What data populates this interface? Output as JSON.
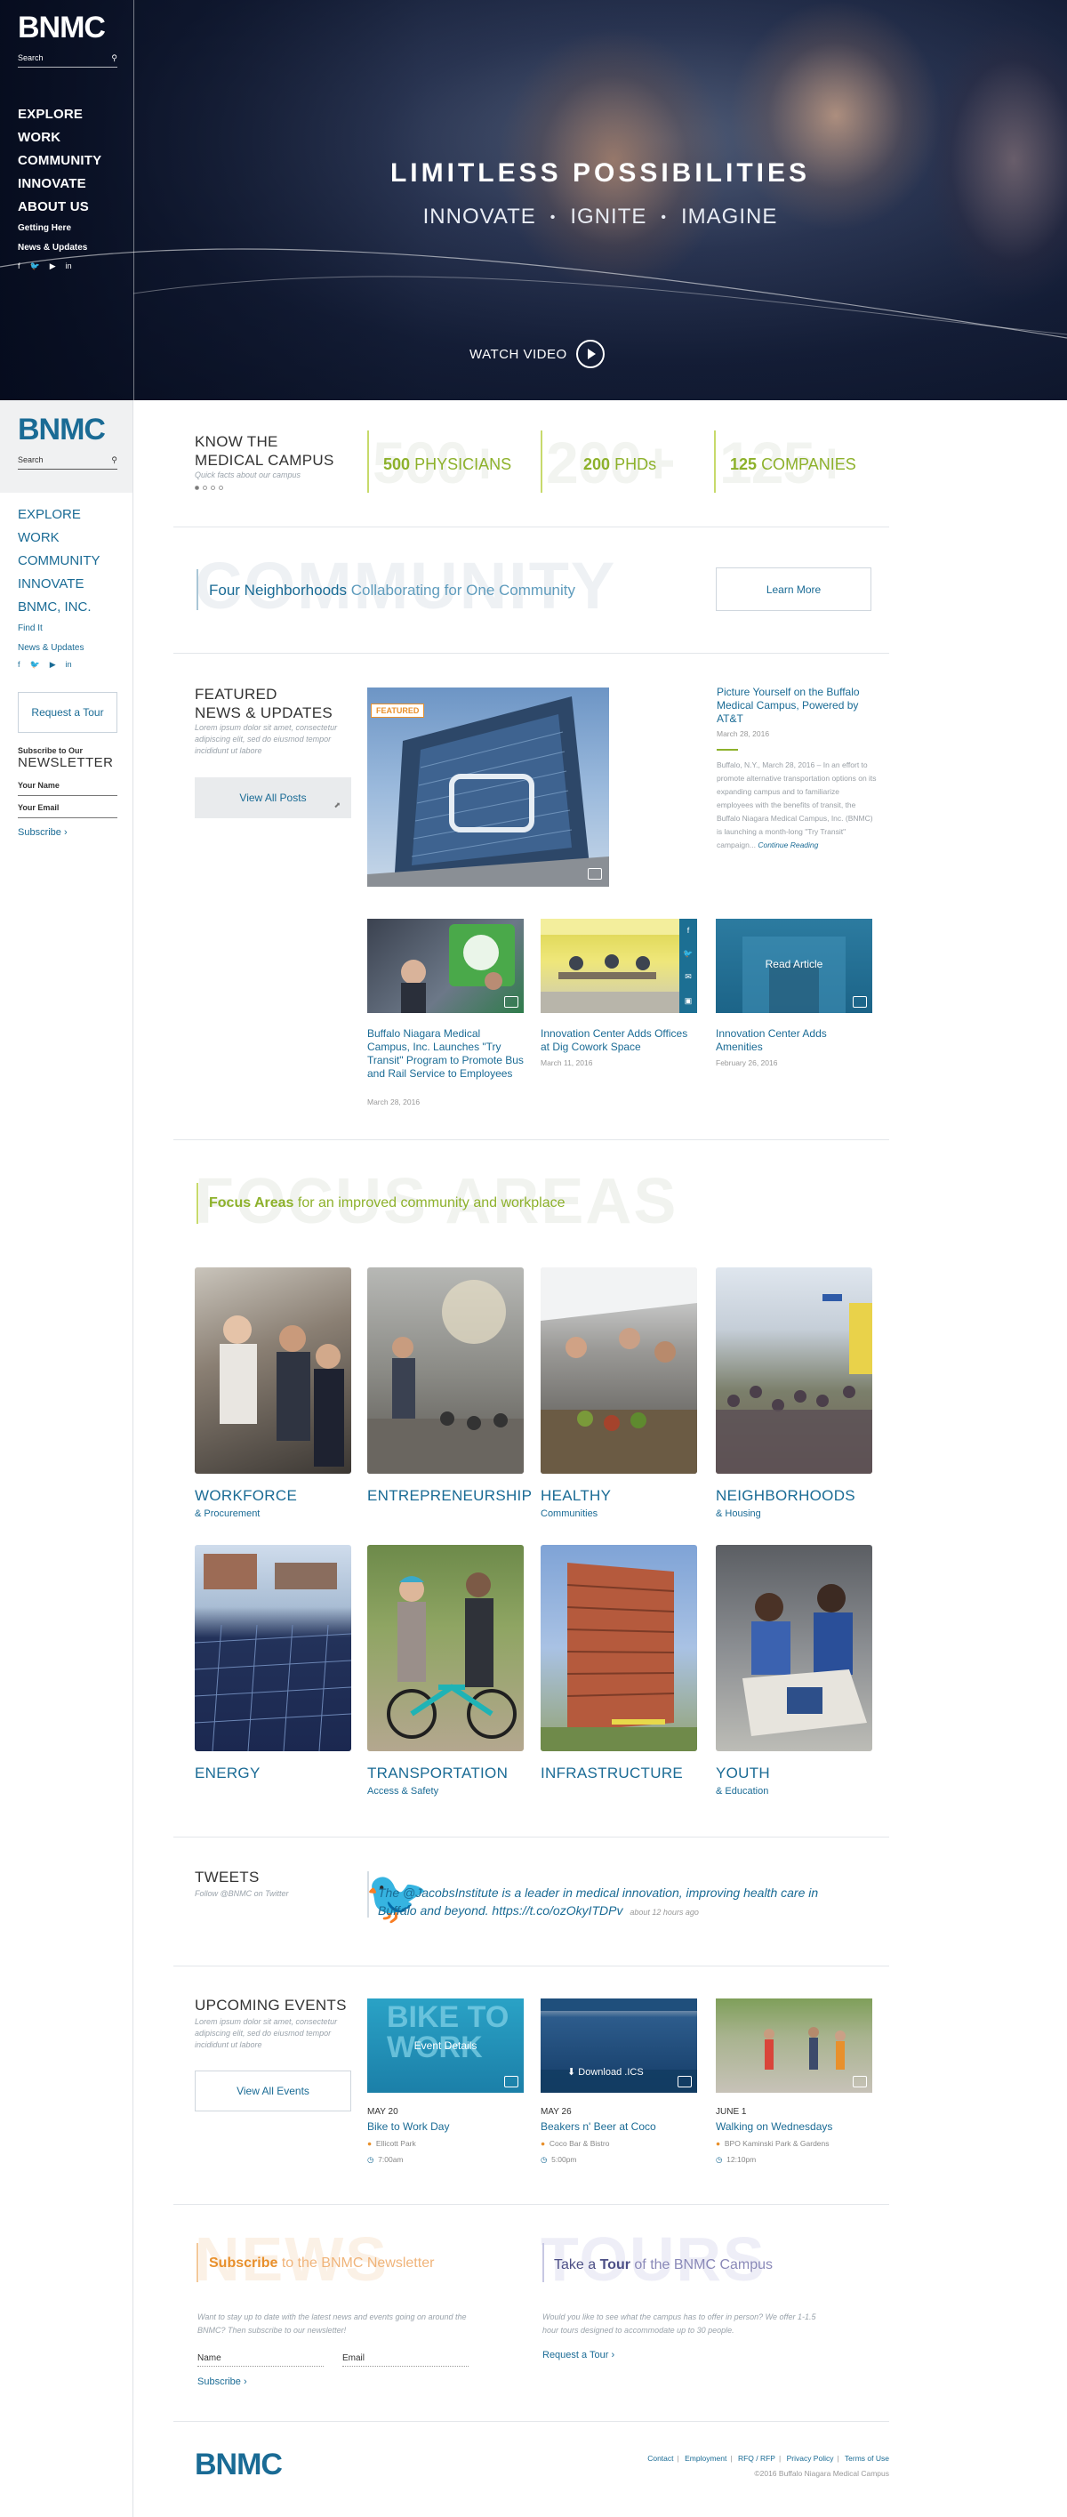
{
  "brand": {
    "logo": "BNMC",
    "accent": "#1a6b95",
    "green": "#8db12b",
    "orange": "#e8902c"
  },
  "hero": {
    "title": "LIMITLESS POSSIBILITIES",
    "subtitle": [
      "INNOVATE",
      "IGNITE",
      "IMAGINE"
    ],
    "watch_label": "WATCH VIDEO",
    "search_label": "Search",
    "menu_main": [
      "EXPLORE",
      "WORK",
      "COMMUNITY",
      "INNOVATE",
      "ABOUT US"
    ],
    "menu_small": [
      "Getting Here",
      "News & Updates"
    ]
  },
  "sidebar": {
    "search_label": "Search",
    "menu_main": [
      "EXPLORE",
      "WORK",
      "COMMUNITY",
      "INNOVATE",
      "BNMC, INC."
    ],
    "menu_small": [
      "Find It",
      "News & Updates"
    ],
    "social": [
      "facebook-icon",
      "twitter-icon",
      "youtube-icon",
      "linkedin-icon"
    ],
    "tour_button": "Request a Tour",
    "newsletter": {
      "small": "Subscribe to Our",
      "big": "NEWSLETTER",
      "name_label": "Your Name",
      "email_label": "Your Email",
      "subscribe": "Subscribe ›"
    }
  },
  "know": {
    "title_line1": "KNOW THE",
    "title_line2": "MEDICAL CAMPUS",
    "subtitle": "Quick facts about our campus",
    "stats": [
      {
        "ghost": "500+",
        "value": "500",
        "label": "PHYSICIANS"
      },
      {
        "ghost": "200+",
        "value": "200",
        "label": "PHDs"
      },
      {
        "ghost": "125+",
        "value": "125",
        "label": "COMPANIES"
      }
    ]
  },
  "community": {
    "ghost": "COMMUNITY",
    "strong": "Four Neighborhoods",
    "rest": "Collaborating for One Community",
    "button": "Learn More"
  },
  "featured": {
    "title_line1": "FEATURED",
    "title_line2": "NEWS & UPDATES",
    "intro": "Lorem ipsum dolor sit amet, consectetur adipiscing elit, sed do eiusmod tempor incididunt ut labore",
    "button": "View All Posts",
    "badge": "FEATURED",
    "main_article": {
      "title": "Picture Yourself on the Buffalo Medical Campus, Powered by AT&T",
      "date": "March 28, 2016",
      "excerpt": "Buffalo, N.Y., March 28, 2016 – In an effort to promote alternative transportation options on its expanding campus and to familiarize employees with the benefits of transit, the Buffalo Niagara Medical Campus, Inc. (BNMC) is launching a month-long \"Try Transit\" campaign...",
      "more": "Continue Reading"
    },
    "articles": [
      {
        "title": "Buffalo Niagara Medical Campus, Inc. Launches \"Try Transit\" Program to Promote Bus and Rail Service to Employees",
        "date": "March 28, 2016"
      },
      {
        "title": "Innovation Center Adds Offices at Dig Cowork Space",
        "date": "March 11, 2016"
      },
      {
        "title": "Innovation Center Adds Amenities",
        "date": "February 26, 2016",
        "hover": "Read Article"
      }
    ]
  },
  "focus": {
    "ghost": "FOCUS AREAS",
    "strong": "Focus Areas",
    "rest": "for an improved community and workplace",
    "items": [
      {
        "title": "WORKFORCE",
        "sub": "& Procurement"
      },
      {
        "title": "ENTREPRENEURSHIP",
        "sub": ""
      },
      {
        "title": "HEALTHY",
        "sub": "Communities"
      },
      {
        "title": "NEIGHBORHOODS",
        "sub": "& Housing"
      },
      {
        "title": "ENERGY",
        "sub": ""
      },
      {
        "title": "TRANSPORTATION",
        "sub": "Access & Safety"
      },
      {
        "title": "INFRASTRUCTURE",
        "sub": ""
      },
      {
        "title": "YOUTH",
        "sub": "& Education"
      }
    ]
  },
  "tweets": {
    "title": "TWEETS",
    "follow": "Follow @BNMC on Twitter",
    "text": "The @JacobsInstitute is a leader in medical innovation, improving health care in Buffalo and beyond. https://t.co/ozOkyITDPv",
    "ago": "about 12 hours ago"
  },
  "events": {
    "title": "UPCOMING EVENTS",
    "intro": "Lorem ipsum dolor sit amet, consectetur adipiscing elit, sed do eiusmod tempor incididunt ut labore",
    "button": "View All Events",
    "items": [
      {
        "date": "MAY 20",
        "title": "Bike to Work Day",
        "place": "Ellicott Park",
        "time": "7:00am",
        "hover": "Event Details",
        "img_text": "BIKE TO WORK"
      },
      {
        "date": "MAY 26",
        "title": "Beakers n' Beer at Coco",
        "place": "Coco Bar & Bistro",
        "time": "5:00pm",
        "hover": "Download .ICS"
      },
      {
        "date": "JUNE 1",
        "title": "Walking on Wednesdays",
        "place": "BPO Kaminski Park & Gardens",
        "time": "12:10pm"
      }
    ]
  },
  "newsletter_cta": {
    "ghost": "NEWS",
    "strong": "Subscribe",
    "rest": "to the BNMC Newsletter",
    "text": "Want to stay up to date with the latest news and events going on around the BNMC? Then subscribe to our newsletter!",
    "name_label": "Name",
    "email_label": "Email",
    "subscribe": "Subscribe ›"
  },
  "tours_cta": {
    "ghost": "TOURS",
    "lead": "Take a",
    "strong": "Tour",
    "rest": "of the BNMC Campus",
    "text": "Would you like to see what the campus has to offer in person? We offer 1-1.5 hour tours designed to accommodate up to 30 people.",
    "link": "Request a Tour ›"
  },
  "footer": {
    "links": [
      "Contact",
      "Employment",
      "RFQ / RFP",
      "Privacy Policy",
      "Terms of Use"
    ],
    "copyright": "©2016 Buffalo Niagara Medical Campus"
  }
}
